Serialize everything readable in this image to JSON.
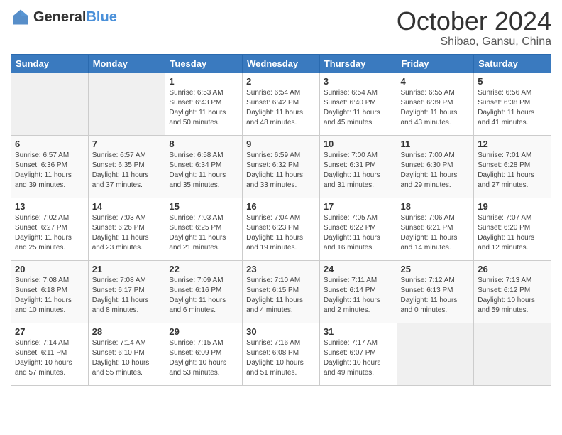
{
  "header": {
    "logo_general": "General",
    "logo_blue": "Blue",
    "month_title": "October 2024",
    "location": "Shibao, Gansu, China"
  },
  "weekdays": [
    "Sunday",
    "Monday",
    "Tuesday",
    "Wednesday",
    "Thursday",
    "Friday",
    "Saturday"
  ],
  "weeks": [
    [
      {
        "day": "",
        "sunrise": "",
        "sunset": "",
        "daylight": "",
        "empty": true
      },
      {
        "day": "",
        "sunrise": "",
        "sunset": "",
        "daylight": "",
        "empty": true
      },
      {
        "day": "1",
        "sunrise": "Sunrise: 6:53 AM",
        "sunset": "Sunset: 6:43 PM",
        "daylight": "Daylight: 11 hours and 50 minutes.",
        "empty": false
      },
      {
        "day": "2",
        "sunrise": "Sunrise: 6:54 AM",
        "sunset": "Sunset: 6:42 PM",
        "daylight": "Daylight: 11 hours and 48 minutes.",
        "empty": false
      },
      {
        "day": "3",
        "sunrise": "Sunrise: 6:54 AM",
        "sunset": "Sunset: 6:40 PM",
        "daylight": "Daylight: 11 hours and 45 minutes.",
        "empty": false
      },
      {
        "day": "4",
        "sunrise": "Sunrise: 6:55 AM",
        "sunset": "Sunset: 6:39 PM",
        "daylight": "Daylight: 11 hours and 43 minutes.",
        "empty": false
      },
      {
        "day": "5",
        "sunrise": "Sunrise: 6:56 AM",
        "sunset": "Sunset: 6:38 PM",
        "daylight": "Daylight: 11 hours and 41 minutes.",
        "empty": false
      }
    ],
    [
      {
        "day": "6",
        "sunrise": "Sunrise: 6:57 AM",
        "sunset": "Sunset: 6:36 PM",
        "daylight": "Daylight: 11 hours and 39 minutes.",
        "empty": false
      },
      {
        "day": "7",
        "sunrise": "Sunrise: 6:57 AM",
        "sunset": "Sunset: 6:35 PM",
        "daylight": "Daylight: 11 hours and 37 minutes.",
        "empty": false
      },
      {
        "day": "8",
        "sunrise": "Sunrise: 6:58 AM",
        "sunset": "Sunset: 6:34 PM",
        "daylight": "Daylight: 11 hours and 35 minutes.",
        "empty": false
      },
      {
        "day": "9",
        "sunrise": "Sunrise: 6:59 AM",
        "sunset": "Sunset: 6:32 PM",
        "daylight": "Daylight: 11 hours and 33 minutes.",
        "empty": false
      },
      {
        "day": "10",
        "sunrise": "Sunrise: 7:00 AM",
        "sunset": "Sunset: 6:31 PM",
        "daylight": "Daylight: 11 hours and 31 minutes.",
        "empty": false
      },
      {
        "day": "11",
        "sunrise": "Sunrise: 7:00 AM",
        "sunset": "Sunset: 6:30 PM",
        "daylight": "Daylight: 11 hours and 29 minutes.",
        "empty": false
      },
      {
        "day": "12",
        "sunrise": "Sunrise: 7:01 AM",
        "sunset": "Sunset: 6:28 PM",
        "daylight": "Daylight: 11 hours and 27 minutes.",
        "empty": false
      }
    ],
    [
      {
        "day": "13",
        "sunrise": "Sunrise: 7:02 AM",
        "sunset": "Sunset: 6:27 PM",
        "daylight": "Daylight: 11 hours and 25 minutes.",
        "empty": false
      },
      {
        "day": "14",
        "sunrise": "Sunrise: 7:03 AM",
        "sunset": "Sunset: 6:26 PM",
        "daylight": "Daylight: 11 hours and 23 minutes.",
        "empty": false
      },
      {
        "day": "15",
        "sunrise": "Sunrise: 7:03 AM",
        "sunset": "Sunset: 6:25 PM",
        "daylight": "Daylight: 11 hours and 21 minutes.",
        "empty": false
      },
      {
        "day": "16",
        "sunrise": "Sunrise: 7:04 AM",
        "sunset": "Sunset: 6:23 PM",
        "daylight": "Daylight: 11 hours and 19 minutes.",
        "empty": false
      },
      {
        "day": "17",
        "sunrise": "Sunrise: 7:05 AM",
        "sunset": "Sunset: 6:22 PM",
        "daylight": "Daylight: 11 hours and 16 minutes.",
        "empty": false
      },
      {
        "day": "18",
        "sunrise": "Sunrise: 7:06 AM",
        "sunset": "Sunset: 6:21 PM",
        "daylight": "Daylight: 11 hours and 14 minutes.",
        "empty": false
      },
      {
        "day": "19",
        "sunrise": "Sunrise: 7:07 AM",
        "sunset": "Sunset: 6:20 PM",
        "daylight": "Daylight: 11 hours and 12 minutes.",
        "empty": false
      }
    ],
    [
      {
        "day": "20",
        "sunrise": "Sunrise: 7:08 AM",
        "sunset": "Sunset: 6:18 PM",
        "daylight": "Daylight: 11 hours and 10 minutes.",
        "empty": false
      },
      {
        "day": "21",
        "sunrise": "Sunrise: 7:08 AM",
        "sunset": "Sunset: 6:17 PM",
        "daylight": "Daylight: 11 hours and 8 minutes.",
        "empty": false
      },
      {
        "day": "22",
        "sunrise": "Sunrise: 7:09 AM",
        "sunset": "Sunset: 6:16 PM",
        "daylight": "Daylight: 11 hours and 6 minutes.",
        "empty": false
      },
      {
        "day": "23",
        "sunrise": "Sunrise: 7:10 AM",
        "sunset": "Sunset: 6:15 PM",
        "daylight": "Daylight: 11 hours and 4 minutes.",
        "empty": false
      },
      {
        "day": "24",
        "sunrise": "Sunrise: 7:11 AM",
        "sunset": "Sunset: 6:14 PM",
        "daylight": "Daylight: 11 hours and 2 minutes.",
        "empty": false
      },
      {
        "day": "25",
        "sunrise": "Sunrise: 7:12 AM",
        "sunset": "Sunset: 6:13 PM",
        "daylight": "Daylight: 11 hours and 0 minutes.",
        "empty": false
      },
      {
        "day": "26",
        "sunrise": "Sunrise: 7:13 AM",
        "sunset": "Sunset: 6:12 PM",
        "daylight": "Daylight: 10 hours and 59 minutes.",
        "empty": false
      }
    ],
    [
      {
        "day": "27",
        "sunrise": "Sunrise: 7:14 AM",
        "sunset": "Sunset: 6:11 PM",
        "daylight": "Daylight: 10 hours and 57 minutes.",
        "empty": false
      },
      {
        "day": "28",
        "sunrise": "Sunrise: 7:14 AM",
        "sunset": "Sunset: 6:10 PM",
        "daylight": "Daylight: 10 hours and 55 minutes.",
        "empty": false
      },
      {
        "day": "29",
        "sunrise": "Sunrise: 7:15 AM",
        "sunset": "Sunset: 6:09 PM",
        "daylight": "Daylight: 10 hours and 53 minutes.",
        "empty": false
      },
      {
        "day": "30",
        "sunrise": "Sunrise: 7:16 AM",
        "sunset": "Sunset: 6:08 PM",
        "daylight": "Daylight: 10 hours and 51 minutes.",
        "empty": false
      },
      {
        "day": "31",
        "sunrise": "Sunrise: 7:17 AM",
        "sunset": "Sunset: 6:07 PM",
        "daylight": "Daylight: 10 hours and 49 minutes.",
        "empty": false
      },
      {
        "day": "",
        "sunrise": "",
        "sunset": "",
        "daylight": "",
        "empty": true
      },
      {
        "day": "",
        "sunrise": "",
        "sunset": "",
        "daylight": "",
        "empty": true
      }
    ]
  ]
}
